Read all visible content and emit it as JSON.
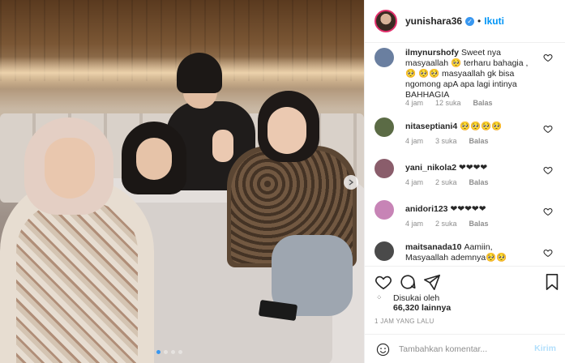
{
  "post": {
    "username": "yunishara36",
    "verified_icon": "verified-badge-icon",
    "separator": "•",
    "follow_label": "Ikuti"
  },
  "comments": [
    {
      "username": "ilmynurshofy",
      "text": "Sweet nya masyaallah 🥺 terharu bahagia , 🥺 🥺🥺 masyaallah gk bisa ngomong apA apa lagi intinya BAHHAGIA",
      "time": "4 jam",
      "likes": "12 suka",
      "reply": "Balas",
      "avatar_color": "#6a7fa0"
    },
    {
      "username": "nitaseptiani4",
      "text": "🥺🥺🥺🥺",
      "time": "4 jam",
      "likes": "3 suka",
      "reply": "Balas",
      "avatar_color": "#5b6b45"
    },
    {
      "username": "yani_nikola2",
      "text": "❤❤❤❤",
      "time": "4 jam",
      "likes": "2 suka",
      "reply": "Balas",
      "avatar_color": "#8a5d6b"
    },
    {
      "username": "anidori123",
      "text": "❤❤❤❤❤",
      "time": "4 jam",
      "likes": "2 suka",
      "reply": "Balas",
      "avatar_color": "#c784b6"
    },
    {
      "username": "maitsanada10",
      "text": "Aamiin, Masyaallah ademnya🥺🥺",
      "time": "",
      "likes": "",
      "reply": "",
      "avatar_color": "#4a4a4a"
    }
  ],
  "likes": {
    "prefix": "Disukai oleh",
    "count": "66,320 lainnya",
    "marker": "⁘"
  },
  "timestamp": "1 JAM YANG LALU",
  "comment_box": {
    "placeholder": "Tambahkan komentar...",
    "post_label": "Kirim"
  },
  "colors": {
    "accent": "#0095f6",
    "verified": "#3897f0",
    "text": "#262626",
    "muted": "#8e8e8e"
  }
}
